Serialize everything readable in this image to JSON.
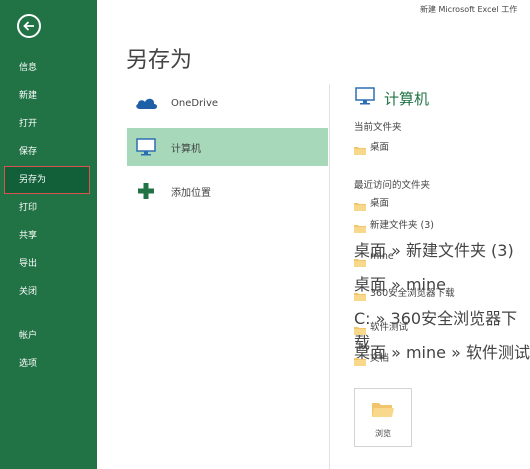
{
  "window_title": "新建 Microsoft Excel 工作",
  "sidebar": {
    "items": [
      {
        "label": "信息"
      },
      {
        "label": "新建"
      },
      {
        "label": "打开"
      },
      {
        "label": "保存"
      },
      {
        "label": "另存为"
      },
      {
        "label": "打印"
      },
      {
        "label": "共享"
      },
      {
        "label": "导出"
      },
      {
        "label": "关闭"
      },
      {
        "label": "帐户"
      },
      {
        "label": "选项"
      }
    ],
    "selected": "另存为"
  },
  "page_title": "另存为",
  "locations": [
    {
      "label": "OneDrive",
      "icon": "cloud-icon"
    },
    {
      "label": "计算机",
      "icon": "computer-icon",
      "selected": true
    },
    {
      "label": "添加位置",
      "icon": "plus-icon"
    }
  ],
  "right": {
    "title": "计算机",
    "current_folder_label": "当前文件夹",
    "current_folder": {
      "name": "桌面"
    },
    "recent_label": "最近访问的文件夹",
    "recent": [
      {
        "name": "桌面",
        "path": ""
      },
      {
        "name": "新建文件夹 (3)",
        "path": "桌面 » 新建文件夹 (3)"
      },
      {
        "name": "mine",
        "path": "桌面 » mine"
      },
      {
        "name": "360安全浏览器下载",
        "path": "C: » 360安全浏览器下载"
      },
      {
        "name": "软件测试",
        "path": "桌面 » mine » 软件测试"
      },
      {
        "name": "文档",
        "path": ""
      }
    ],
    "browse_label": "浏览"
  },
  "colors": {
    "accent": "#217346",
    "selected_location": "#a6d8b9",
    "folder": "#f2c46b"
  }
}
